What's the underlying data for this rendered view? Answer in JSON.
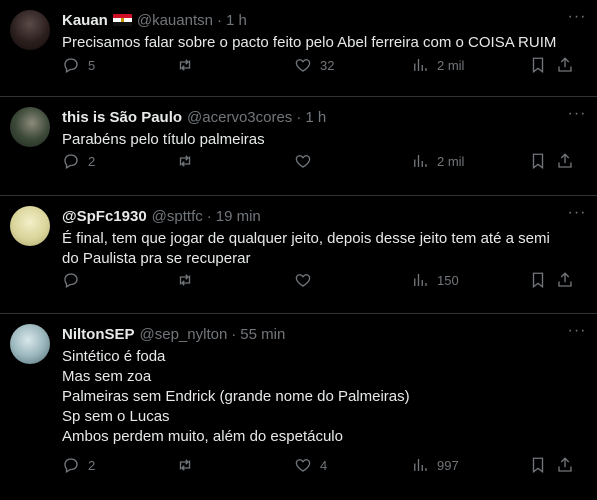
{
  "tweets": [
    {
      "display_name": "Kauan",
      "has_flag": true,
      "handle": "@kauantsn",
      "sep": "·",
      "time": "1 h",
      "text": [
        "Precisamos falar sobre o pacto feito pelo Abel ferreira com o COISA RUIM"
      ],
      "replies": "5",
      "retweets": "",
      "likes": "32",
      "views": "2 mil"
    },
    {
      "display_name": "this is São Paulo",
      "has_flag": false,
      "handle": "@acervo3cores",
      "sep": "·",
      "time": "1 h",
      "text": [
        "Parabéns pelo título palmeiras"
      ],
      "replies": "2",
      "retweets": "",
      "likes": "",
      "views": "2 mil"
    },
    {
      "display_name": "@SpFc1930",
      "has_flag": false,
      "handle": "@spttfc",
      "sep": "·",
      "time": "19 min",
      "text": [
        "É final, tem que jogar de qualquer jeito, depois desse jeito tem até a semi",
        "do Paulista pra se recuperar"
      ],
      "replies": "",
      "retweets": "",
      "likes": "",
      "views": "150"
    },
    {
      "display_name": "NiltonSEP",
      "has_flag": false,
      "handle": "@sep_nylton",
      "sep": "·",
      "time": "55 min",
      "text": [
        "Sintético é foda",
        "Mas sem zoa",
        "Palmeiras sem Endrick (grande nome do Palmeiras)",
        "Sp sem o Lucas",
        "Ambos perdem muito, além do espetáculo"
      ],
      "replies": "2",
      "retweets": "",
      "likes": "4",
      "views": "997"
    }
  ],
  "icons": {
    "reply": "reply-icon",
    "retweet": "retweet-icon",
    "like": "heart-icon",
    "views": "views-icon",
    "bookmark": "bookmark-icon",
    "share": "share-icon",
    "more": "more-icon"
  },
  "colors": {
    "background": "#000000",
    "text": "#e7e9ea",
    "muted": "#71767b",
    "divider": "#2f3336"
  }
}
